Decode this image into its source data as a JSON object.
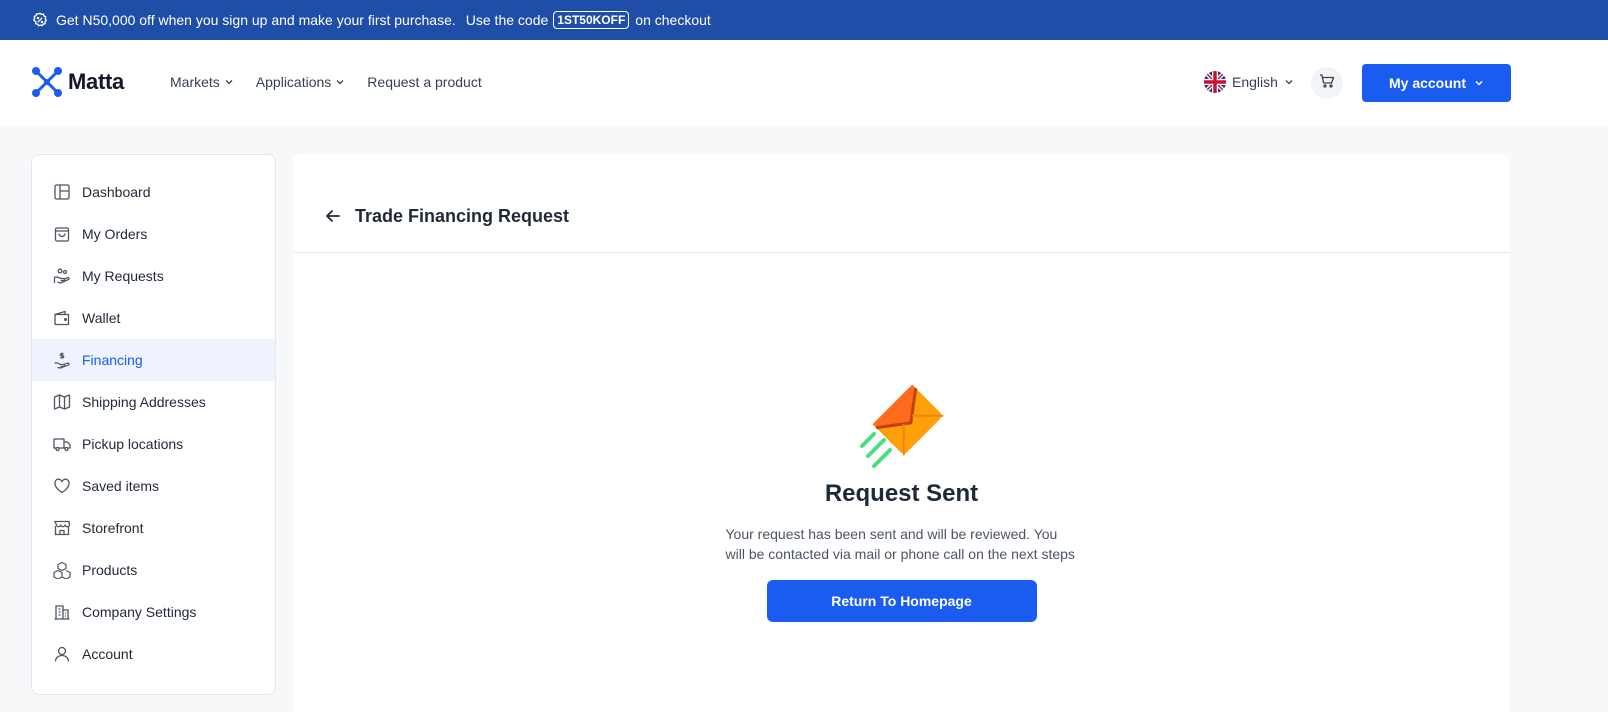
{
  "promo": {
    "text": "Get N50,000 off when you sign up and make your first purchase.",
    "code_prefix": "Use the code",
    "code": "1ST50KOFF",
    "code_suffix": "on checkout",
    "icon": "badge-discount-icon"
  },
  "header": {
    "logo_text": "Matta",
    "nav": [
      {
        "label": "Markets",
        "has_dropdown": true
      },
      {
        "label": "Applications",
        "has_dropdown": true
      },
      {
        "label": "Request a product",
        "has_dropdown": false
      }
    ],
    "language": "English",
    "account_label": "My account"
  },
  "sidebar": {
    "items": [
      {
        "label": "Dashboard",
        "icon": "layout-icon"
      },
      {
        "label": "My Orders",
        "icon": "shopping-bag-icon"
      },
      {
        "label": "My Requests",
        "icon": "hand-request-icon"
      },
      {
        "label": "Wallet",
        "icon": "wallet-icon"
      },
      {
        "label": "Financing",
        "icon": "hand-dollar-icon",
        "active": true
      },
      {
        "label": "Shipping Addresses",
        "icon": "map-icon"
      },
      {
        "label": "Pickup locations",
        "icon": "truck-icon"
      },
      {
        "label": "Saved items",
        "icon": "heart-icon"
      },
      {
        "label": "Storefront",
        "icon": "storefront-icon"
      },
      {
        "label": "Products",
        "icon": "boxes-icon"
      },
      {
        "label": "Company Settings",
        "icon": "building-icon"
      },
      {
        "label": "Account",
        "icon": "user-icon"
      }
    ]
  },
  "main": {
    "title": "Trade Financing Request",
    "success_title": "Request Sent",
    "success_message": "Your request has been sent and will be reviewed. You will be contacted via mail or phone call on the next steps",
    "return_button": "Return To Homepage"
  },
  "colors": {
    "brand_blue": "#1a5bf0",
    "promo_bar": "#1f4ea8",
    "active_bg": "#eef3fd"
  }
}
